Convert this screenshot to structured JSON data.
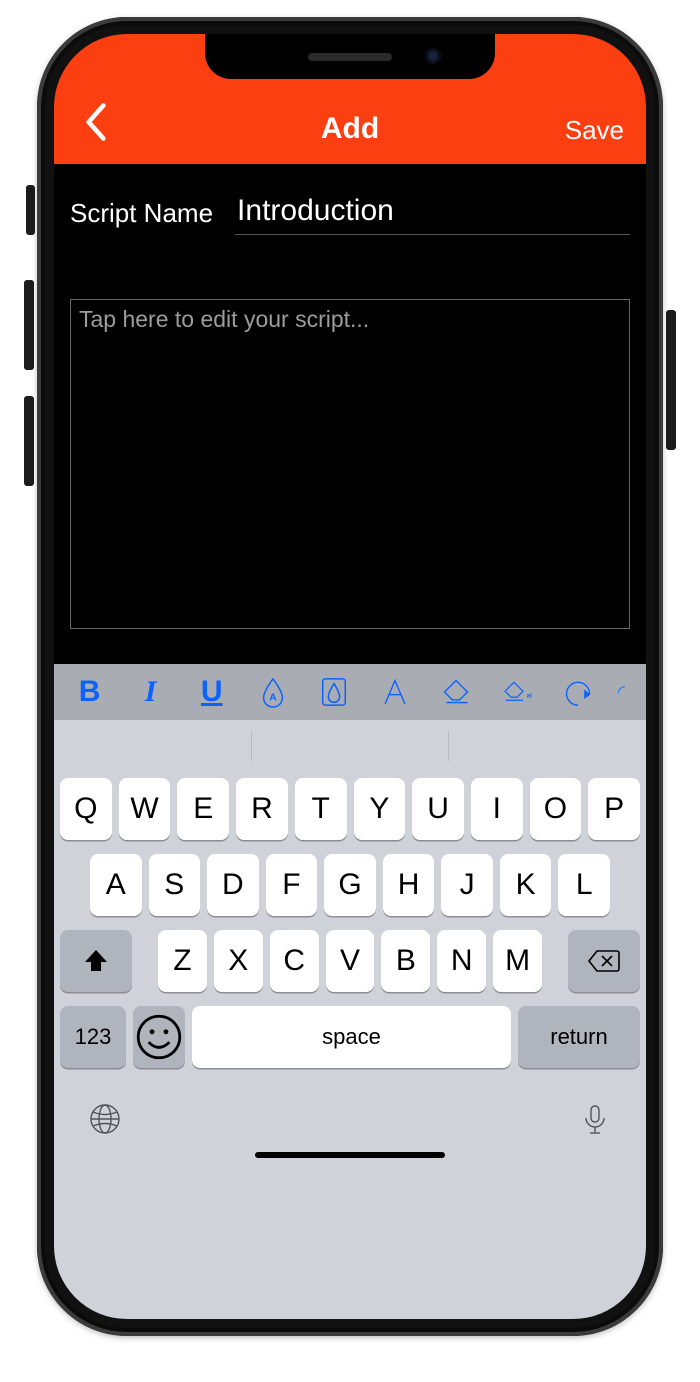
{
  "colors": {
    "accent": "#fb3f11",
    "tool_tint": "#0b62ff"
  },
  "navbar": {
    "title": "Add",
    "save_label": "Save"
  },
  "form": {
    "name_label": "Script Name",
    "name_value": "Introduction",
    "script_value": "",
    "script_placeholder": "Tap here to edit your script..."
  },
  "format_toolbar": {
    "tools": [
      "bold",
      "italic",
      "underline",
      "text-color",
      "highlight",
      "font",
      "eraser",
      "erase-all",
      "undo",
      "redo"
    ]
  },
  "keyboard": {
    "row1": [
      "Q",
      "W",
      "E",
      "R",
      "T",
      "Y",
      "U",
      "I",
      "O",
      "P"
    ],
    "row2": [
      "A",
      "S",
      "D",
      "F",
      "G",
      "H",
      "J",
      "K",
      "L"
    ],
    "row3": [
      "Z",
      "X",
      "C",
      "V",
      "B",
      "N",
      "M"
    ],
    "numbers_label": "123",
    "space_label": "space",
    "return_label": "return"
  }
}
